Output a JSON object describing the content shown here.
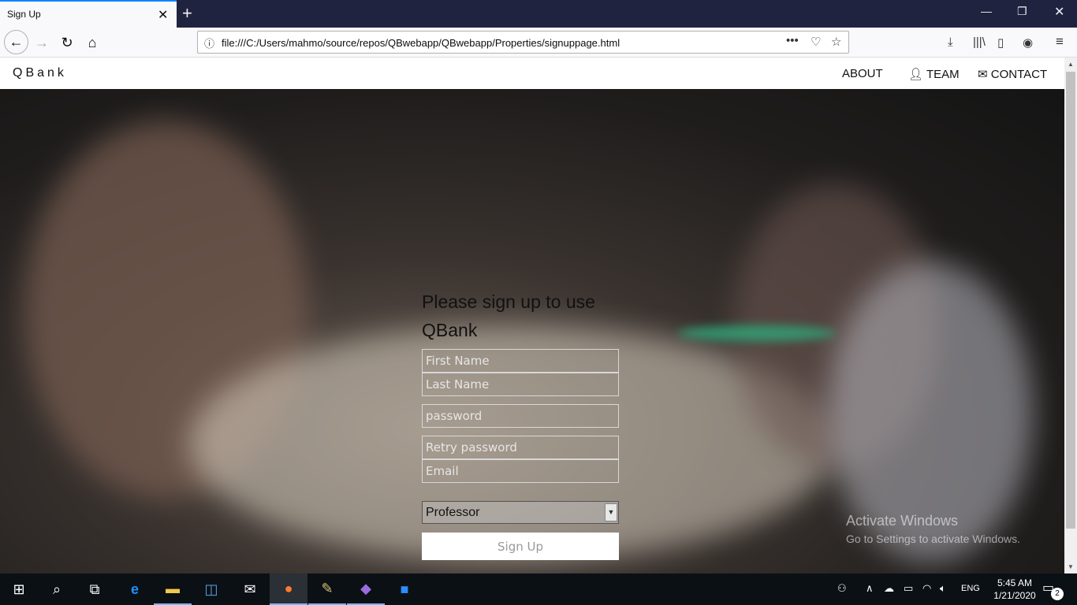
{
  "browser": {
    "tab_title": "Sign Up",
    "url": "file:///C:/Users/mahmo/source/repos/QBwebapp/QBwebapp/Properties/signuppage.html"
  },
  "site": {
    "brand": "QBank",
    "menu": {
      "about": "ABOUT",
      "team": "TEAM",
      "contact": "CONTACT"
    }
  },
  "form": {
    "title": "Please sign up to use QBank",
    "first_name_placeholder": "First Name",
    "last_name_placeholder": "Last Name",
    "password_placeholder": "password",
    "retry_password_placeholder": "Retry password",
    "email_placeholder": "Email",
    "role_selected": "Professor",
    "submit_label": "Sign Up"
  },
  "watermark": {
    "title": "Activate Windows",
    "subtitle": "Go to Settings to activate Windows."
  },
  "taskbar": {
    "language": "ENG",
    "time": "5:45 AM",
    "date": "1/21/2020",
    "notification_count": "2"
  }
}
